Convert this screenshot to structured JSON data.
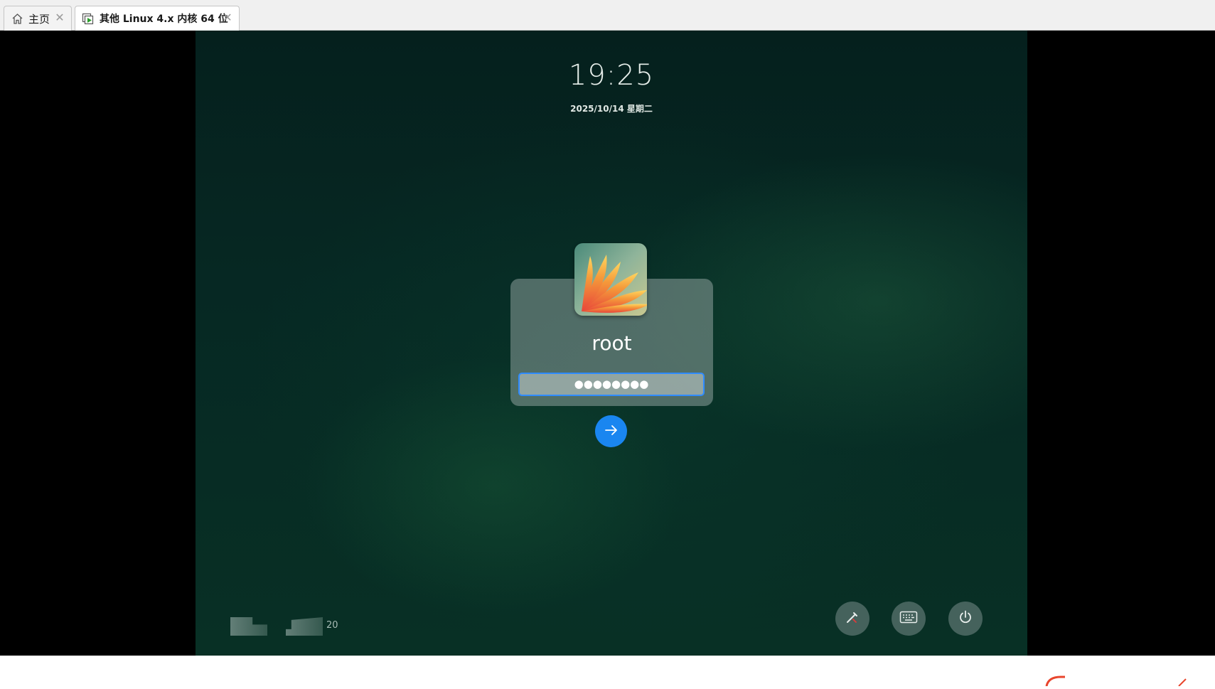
{
  "tabs": [
    {
      "label": "主页",
      "icon": "home-icon",
      "active": false
    },
    {
      "label": "其他 Linux 4.x 内核 64 位",
      "icon": "vm-play-icon",
      "active": true
    }
  ],
  "lock_screen": {
    "time": "19:25",
    "date": "2025/10/14 星期二",
    "username": "root",
    "password_mask": "●●●●●●●●",
    "tray_number": "20"
  },
  "colors": {
    "accent": "#1a86f0",
    "input_border": "#2f8cff",
    "background": "#062823"
  },
  "icons": {
    "submit": "arrow-right-icon",
    "pen": "pen-icon",
    "keyboard": "keyboard-icon",
    "power": "power-icon"
  }
}
